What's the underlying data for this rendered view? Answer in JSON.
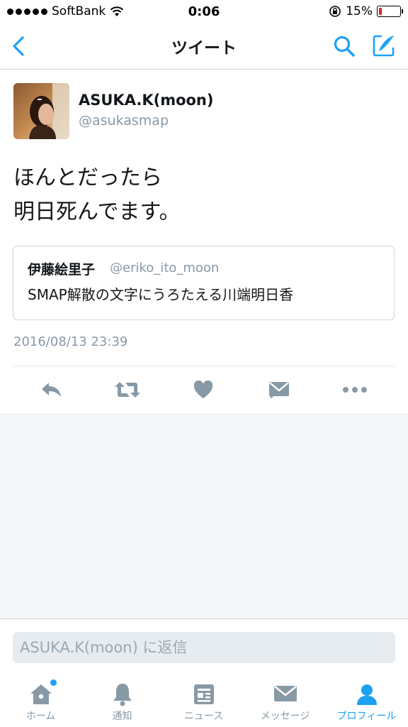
{
  "status_bar": {
    "carrier": "SoftBank",
    "time": "0:06",
    "battery_percent": "15%",
    "battery_level": 0.15,
    "battery_color": "#e0212b"
  },
  "nav": {
    "title": "ツイート",
    "accent_color": "#1da1f2"
  },
  "tweet": {
    "author_name": "ASUKA.K(moon)",
    "author_handle": "@asukasmap",
    "text_line1": "ほんとだったら",
    "text_line2": "明日死んでます。",
    "quote": {
      "author_name": "伊藤絵里子",
      "author_handle": "@eriko_ito_moon",
      "text": "SMAP解散の文字にうろたえる川端明日香"
    },
    "timestamp": "2016/08/13 23:39",
    "actions": [
      "reply-icon",
      "retweet-icon",
      "heart-icon",
      "message-icon",
      "more-icon"
    ]
  },
  "reply": {
    "placeholder": "ASUKA.K(moon) に返信"
  },
  "tabs": [
    {
      "label": "ホーム",
      "icon": "home-icon"
    },
    {
      "label": "通知",
      "icon": "bell-icon"
    },
    {
      "label": "ニュース",
      "icon": "news-icon"
    },
    {
      "label": "メッセージ",
      "icon": "envelope-icon"
    },
    {
      "label": "プロフィール",
      "icon": "person-icon"
    }
  ]
}
